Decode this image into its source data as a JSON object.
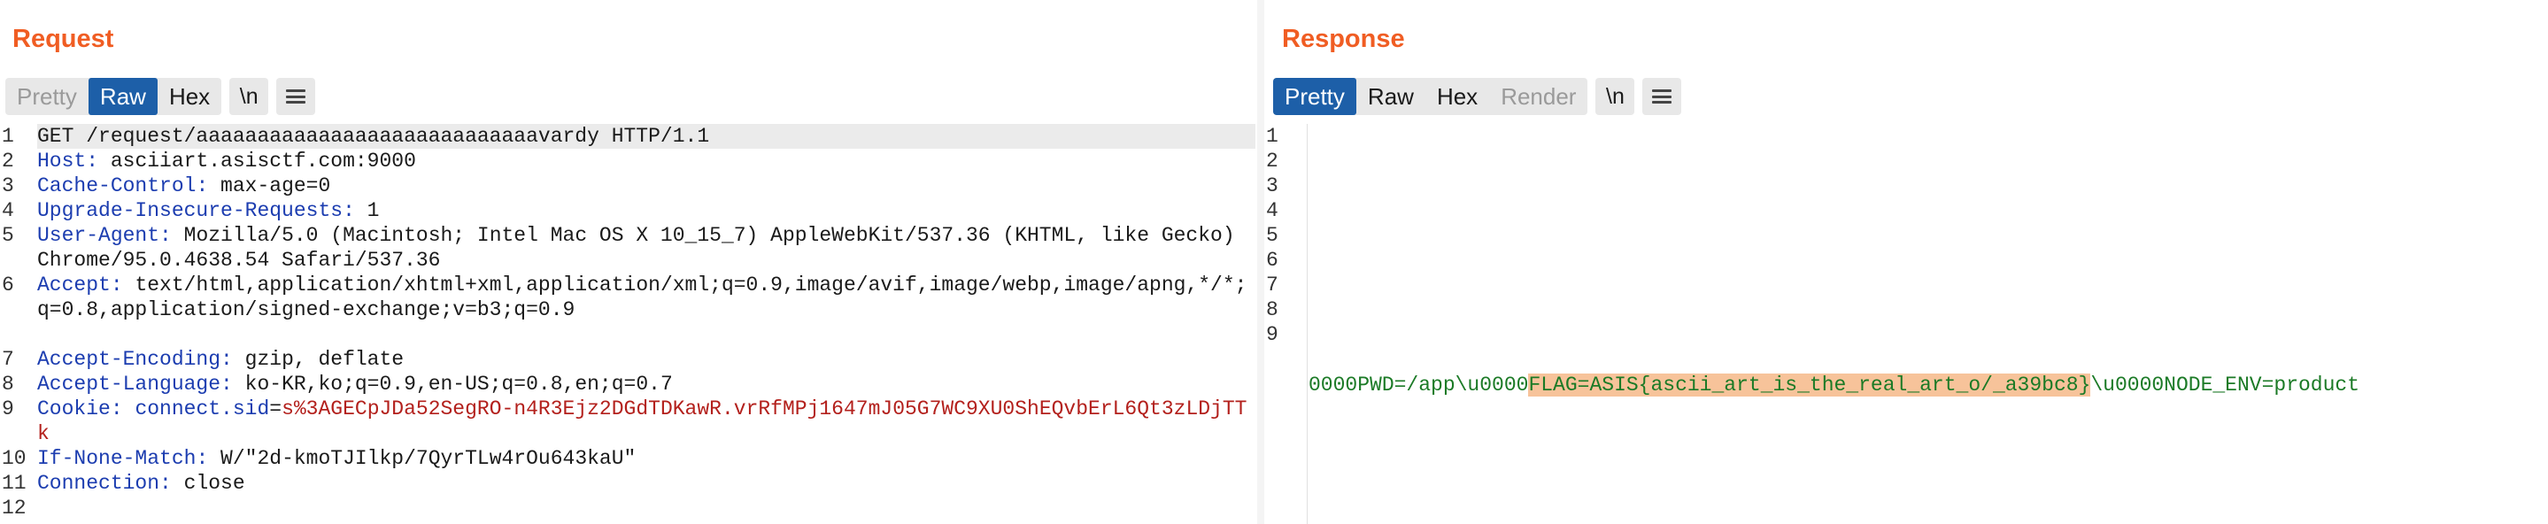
{
  "request": {
    "title": "Request",
    "tabs": [
      {
        "label": "Pretty",
        "state": "disabled"
      },
      {
        "label": "Raw",
        "state": "active"
      },
      {
        "label": "Hex",
        "state": "normal"
      }
    ],
    "newline_toggle": "\\n",
    "lines": [
      {
        "num": "1",
        "text": "GET /request/aaaaaaaaaaaaaaaaaaaaaaaaaaaavardy HTTP/1.1"
      },
      {
        "num": "2",
        "key": "Host",
        "value": " asciiart.asisctf.com:9000"
      },
      {
        "num": "3",
        "key": "Cache-Control",
        "value": " max-age=0"
      },
      {
        "num": "4",
        "key": "Upgrade-Insecure-Requests",
        "value": " 1"
      },
      {
        "num": "5",
        "key": "User-Agent",
        "value": " Mozilla/5.0 (Macintosh; Intel Mac OS X 10_15_7) AppleWebKit/537.36 (KHTML, like Gecko) Chrome/95.0.4638.54 Safari/537.36"
      },
      {
        "num": "6",
        "key": "Accept",
        "value": " text/html,application/xhtml+xml,application/xml;q=0.9,image/avif,image/webp,image/apng,*/*;q=0.8,application/signed-exchange;v=b3;q=0.9"
      },
      {
        "num": "7",
        "key": "Accept-Encoding",
        "value": " gzip, deflate"
      },
      {
        "num": "8",
        "key": "Accept-Language",
        "value": " ko-KR,ko;q=0.9,en-US;q=0.8,en;q=0.7"
      },
      {
        "num": "9",
        "key": "Cookie",
        "cookie_name": "connect.sid",
        "cookie_value": "s%3AGECpJDa52SegRO-n4R3Ejz2DGdTDKawR.vrRfMPj1647mJ05G7WC9XU0ShEQvbErL6Qt3zLDjTTk"
      },
      {
        "num": "10",
        "key": "If-None-Match",
        "value": " W/\"2d-kmoTJIlkp/7QyrTLw4rOu643kaU\""
      },
      {
        "num": "11",
        "key": "Connection",
        "value": " close"
      },
      {
        "num": "12",
        "text": ""
      }
    ]
  },
  "response": {
    "title": "Response",
    "tabs": [
      {
        "label": "Pretty",
        "state": "active"
      },
      {
        "label": "Raw",
        "state": "normal"
      },
      {
        "label": "Hex",
        "state": "normal"
      },
      {
        "label": "Render",
        "state": "disabled"
      }
    ],
    "newline_toggle": "\\n",
    "line_numbers": [
      "1",
      "2",
      "3",
      "4",
      "5",
      "6",
      "7",
      "8",
      "9"
    ],
    "output_prefix": "0000PWD=/app\\u0000",
    "output_flag": "FLAG=ASIS{ascii_art_is_the_real_art_o/_a39bc8}",
    "output_suffix": "\\u0000NODE_ENV=product"
  },
  "layout_switch": {
    "options": [
      "split-horizontal-icon",
      "split-vertical-icon",
      "single-pane-icon"
    ],
    "selected": "split-horizontal-icon"
  },
  "colors": {
    "title": "#f05d23",
    "active_tab": "#1d5fa8",
    "header_key": "#1c3db0",
    "cookie_value": "#b3201c",
    "response_text": "#1b7a26",
    "flag_highlight": "#f7c39a"
  }
}
